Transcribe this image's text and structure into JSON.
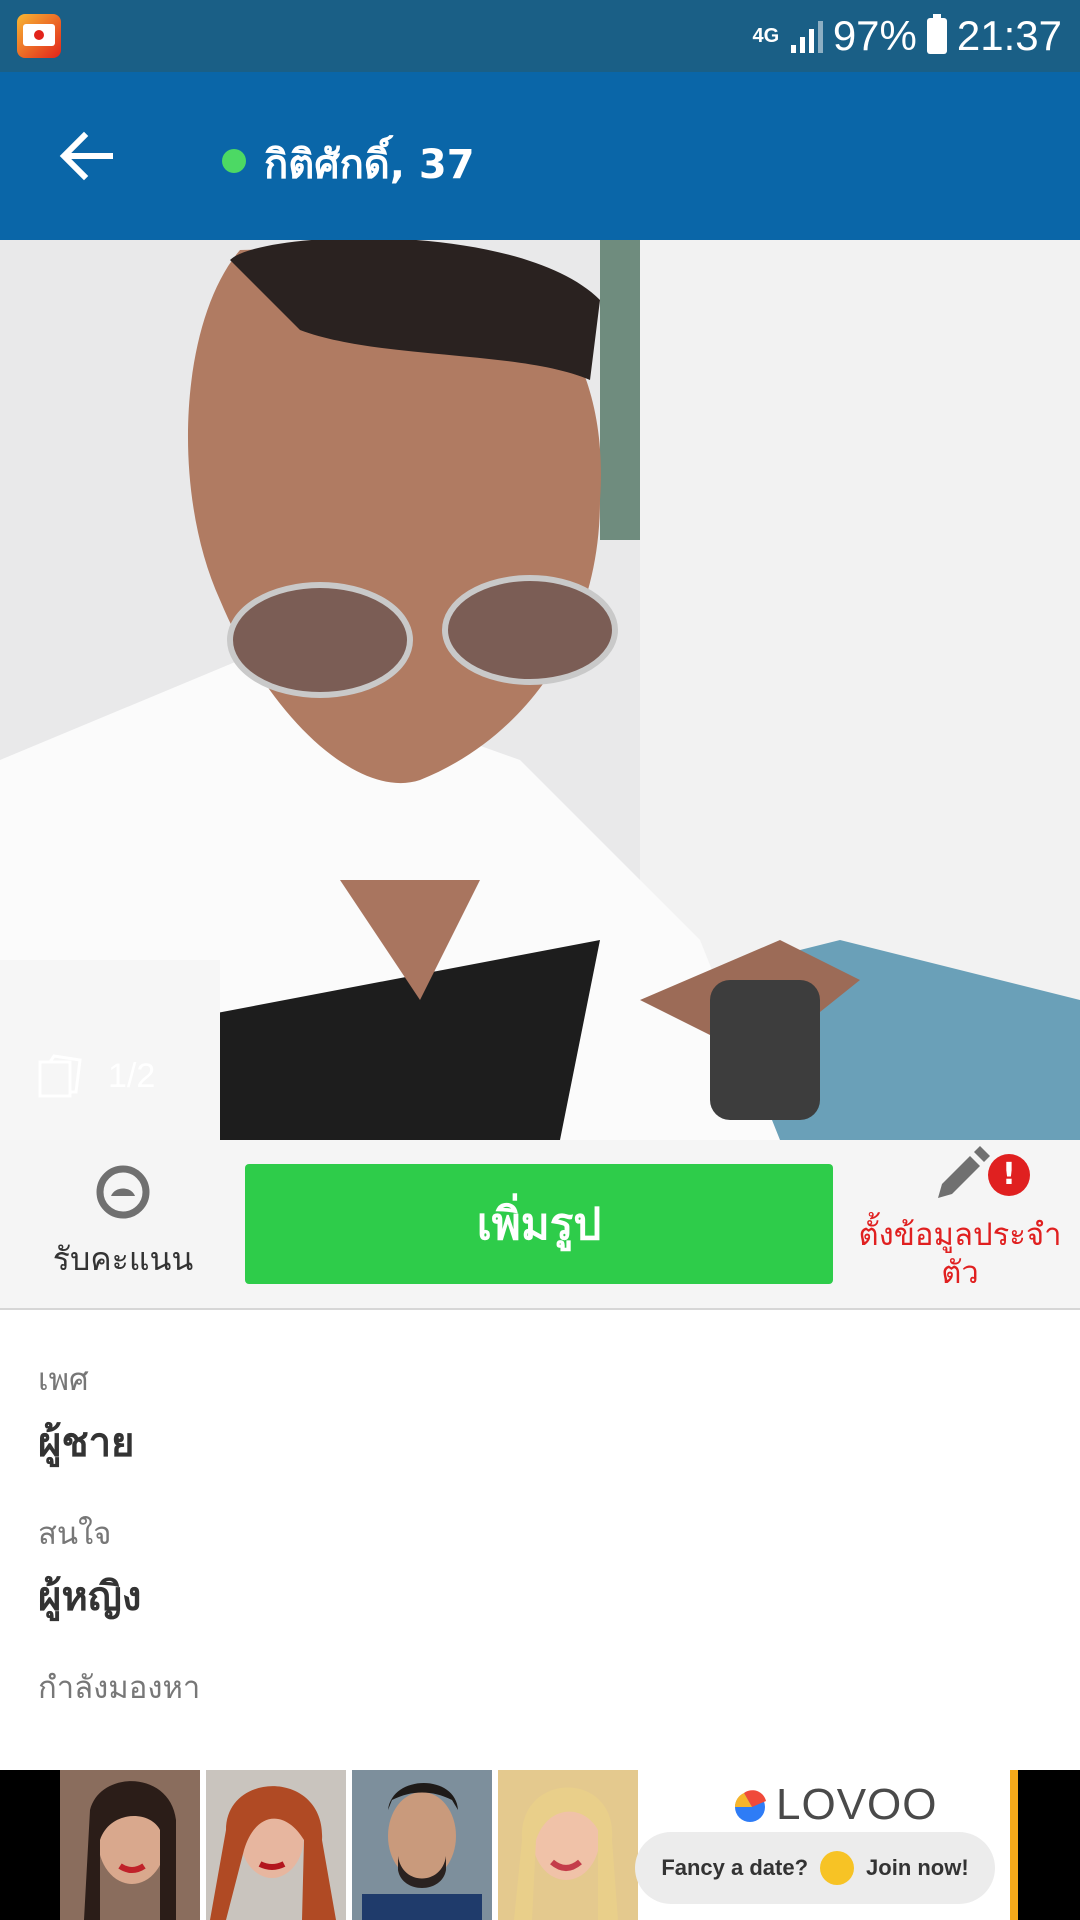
{
  "status_bar": {
    "network": "4G",
    "battery": "97%",
    "time": "21:37"
  },
  "header": {
    "back_label": "Back",
    "title": "กิติศักดิ์, 37"
  },
  "photo": {
    "counter": "1/2"
  },
  "actions": {
    "points_label": "รับคะแนน",
    "add_photo_label": "เพิ่มรูป",
    "profile_setup_label": "ตั้งข้อมูลประจำตัว",
    "alert_mark": "!"
  },
  "info": {
    "gender_label": "เพศ",
    "gender_value": "ผู้ชาย",
    "interest_label": "สนใจ",
    "interest_value": "ผู้หญิง",
    "looking_for_label": "กำลังมองหา"
  },
  "ad": {
    "brand": "LOVOO",
    "cta_text": "Fancy a date?",
    "cta_action": "Join now!"
  },
  "colors": {
    "status_bar": "#1a5f86",
    "app_bar": "#0a66a8",
    "online": "#4cd964",
    "primary_button": "#2ecc4a",
    "alert": "#e02020"
  }
}
